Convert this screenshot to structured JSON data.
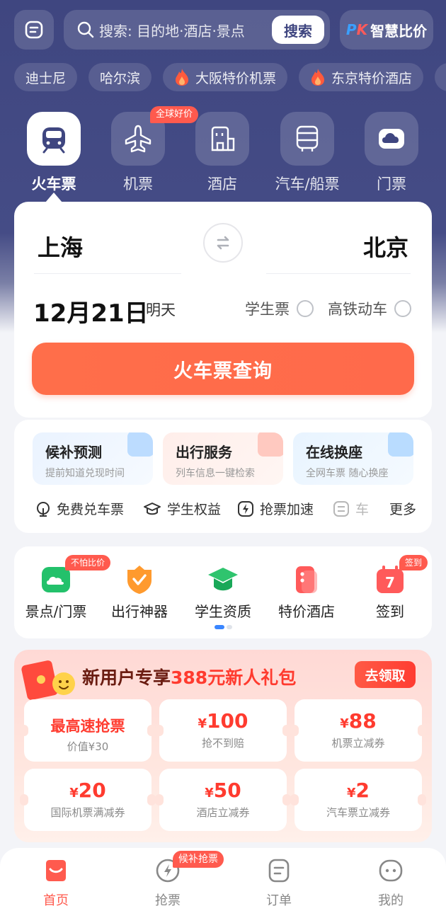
{
  "search": {
    "placeholder": "搜索: 目的地·酒店·景点",
    "button": "搜索",
    "compare_label": "智慧比价",
    "compare_prefix_p": "P",
    "compare_prefix_k": "K"
  },
  "hot_tags": [
    "迪士尼",
    "哈尔滨",
    "大阪特价机票",
    "东京特价酒店"
  ],
  "categories": {
    "items": [
      "火车票",
      "机票",
      "酒店",
      "汽车/船票",
      "门票"
    ],
    "active": "火车票",
    "badge": "全球好价"
  },
  "booking": {
    "from": "上海",
    "to": "北京",
    "date": "12月21日",
    "day_label": "明天",
    "student_option": "学生票",
    "highspeed_option": "高铁动车",
    "query_button": "火车票查询"
  },
  "services": {
    "boxes": [
      {
        "title": "候补预测",
        "sub": "提前知道兑现时间"
      },
      {
        "title": "出行服务",
        "sub": "列车信息一键检索"
      },
      {
        "title": "在线换座",
        "sub": "全网车票 随心换座"
      }
    ],
    "quick": [
      "免费兑车票",
      "学生权益",
      "抢票加速",
      "车"
    ],
    "more": "更多"
  },
  "features": {
    "items": [
      "景点/门票",
      "出行神器",
      "学生资质",
      "特价酒店",
      "签到"
    ],
    "badge_tickets": "不怕比价",
    "badge_checkin": "签到",
    "checkin_number": "7"
  },
  "promo": {
    "title_prefix": "新用户专享",
    "title_highlight": "388元新人礼包",
    "claim_button": "去领取",
    "coupons": [
      {
        "value": "最高速抢票",
        "desc": "价值¥30"
      },
      {
        "currency": "¥",
        "value": "100",
        "desc": "抢不到赔"
      },
      {
        "currency": "¥",
        "value": "88",
        "desc": "机票立减券"
      },
      {
        "currency": "¥",
        "value": "20",
        "desc": "国际机票满减券"
      },
      {
        "currency": "¥",
        "value": "50",
        "desc": "酒店立减券"
      },
      {
        "currency": "¥",
        "value": "2",
        "desc": "汽车票立减券"
      }
    ]
  },
  "bottom_nav": {
    "items": [
      "首页",
      "抢票",
      "订单",
      "我的"
    ],
    "active": "首页",
    "badge": "候补抢票"
  },
  "colors": {
    "header_bg": "#3f4680",
    "accent": "#ff6a4b",
    "badge": "#ff5a4e"
  }
}
